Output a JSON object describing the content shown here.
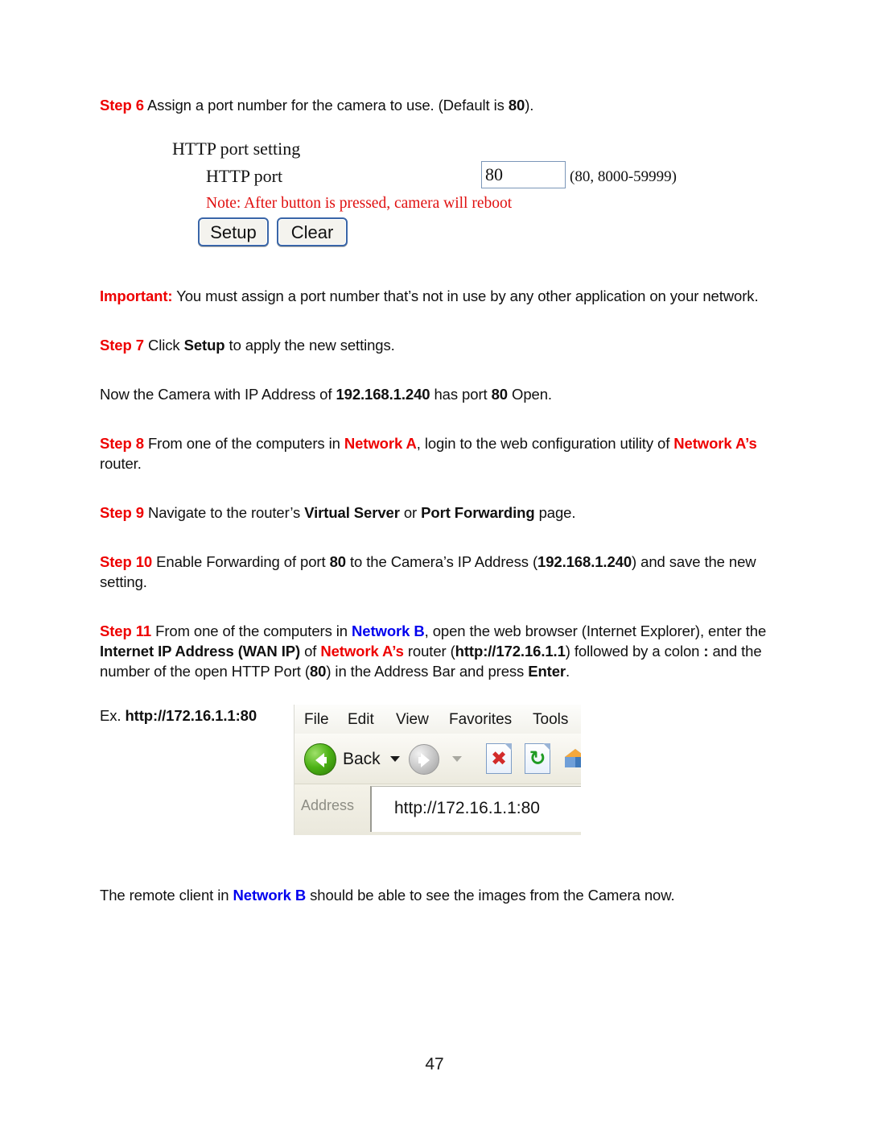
{
  "document": {
    "page_number": "47"
  },
  "steps": {
    "step6": {
      "label": "Step 6",
      "text_before": " Assign a port number for the camera to use. (Default is ",
      "bold_value": "80",
      "text_after": ")."
    },
    "important": {
      "label": "Important:",
      "text": " You must assign a port number that’s not in use by any other application on your network."
    },
    "step7": {
      "label": "Step 7",
      "text_before": " Click ",
      "bold_value": "Setup",
      "text_after": " to apply the new settings."
    },
    "now_line": {
      "text_before": "Now the Camera with IP Address of ",
      "ip": "192.168.1.240",
      "text_mid": " has port ",
      "port": "80",
      "text_after": " Open."
    },
    "step8": {
      "label": "Step 8",
      "text_1": " From one of the computers in ",
      "network_a": "Network A",
      "text_2": ", login to the web configuration utility of ",
      "network_as": "Network A’s",
      "text_3": " router."
    },
    "step9": {
      "label": "Step 9",
      "text_1": " Navigate to the router’s ",
      "bold_1": "Virtual Server",
      "text_2": " or ",
      "bold_2": "Port Forwarding",
      "text_3": " page."
    },
    "step10": {
      "label": "Step 10",
      "text_1": " Enable Forwarding of port ",
      "bold_1": "80",
      "text_2": " to the Camera’s IP Address (",
      "bold_2": "192.168.1.240",
      "text_3": ") and save the new setting."
    },
    "step11": {
      "label": "Step 11",
      "text_1": " From one of the computers in ",
      "network_b": "Network B",
      "text_2": ", open the web browser (Internet Explorer), enter the ",
      "bold_1": "Internet IP Address (WAN IP)",
      "text_3": " of ",
      "network_as": "Network A’s",
      "text_4": " router (",
      "bold_2": "http://172.16.1.1",
      "text_5": ") followed by a colon ",
      "bold_3": ":",
      "text_6": " and the number of the open HTTP Port (",
      "bold_4": "80",
      "text_7": ") in the Address Bar and press ",
      "bold_5": "Enter",
      "text_8": "."
    },
    "example": {
      "prefix": "Ex. ",
      "url": "http://172.16.1.1:80"
    },
    "closing": {
      "text_1": "The remote client in ",
      "network_b": "Network B",
      "text_2": " should be able to see the images from the Camera now."
    }
  },
  "camera_form": {
    "title": "HTTP port setting",
    "port_label": "HTTP port",
    "port_value": "80",
    "port_range": "(80, 8000-59999)",
    "note": "Note: After button is pressed, camera will reboot",
    "setup_button": "Setup",
    "clear_button": "Clear"
  },
  "browser_shot": {
    "menu": [
      "File",
      "Edit",
      "View",
      "Favorites",
      "Tools"
    ],
    "back_label": "Back",
    "address_label": "Address",
    "address_value": "http://172.16.1.1:80",
    "icons": {
      "stop": "✖",
      "refresh": "↻"
    }
  },
  "colors": {
    "step_red": "#ee0000",
    "network_b_blue": "#0000ee",
    "note_red": "#e01010",
    "button_border": "#3a66a8"
  }
}
